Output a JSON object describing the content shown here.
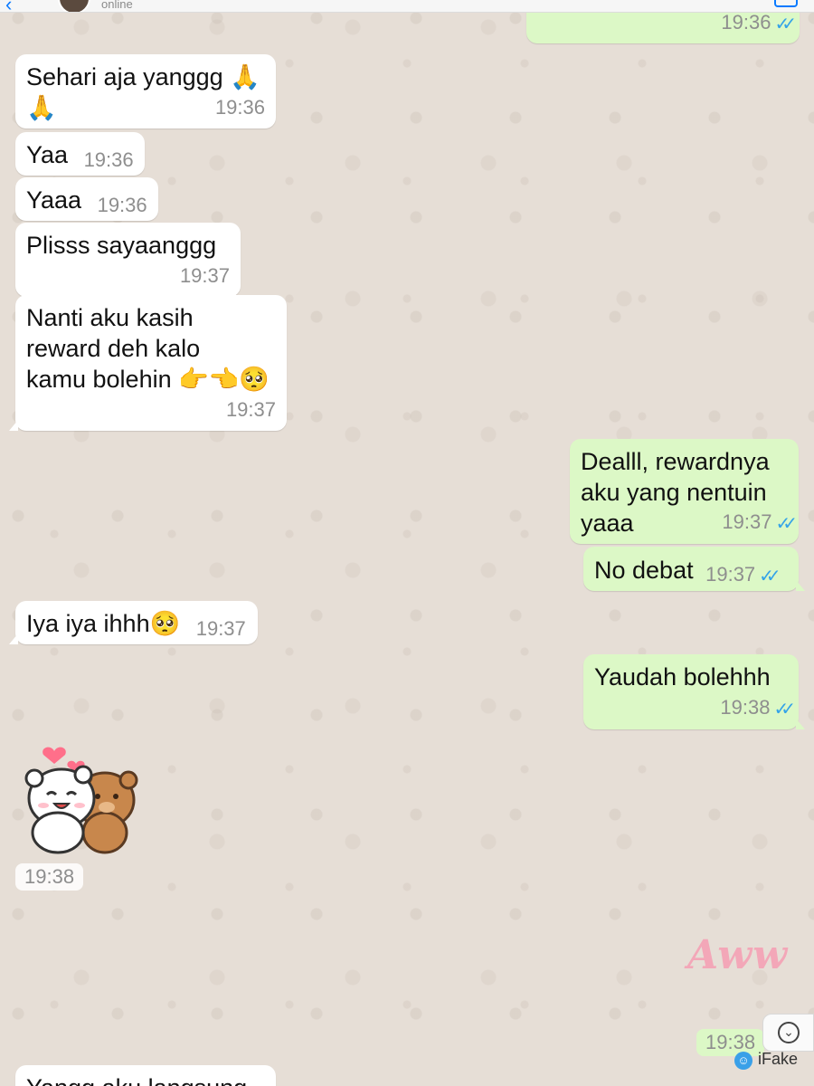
{
  "header": {
    "status": "online"
  },
  "messages": [
    {
      "text": "",
      "time": "19:36",
      "ticks": "✓✓"
    },
    {
      "text": "Sehari aja yanggg 🙏\n🙏",
      "time": "19:36"
    },
    {
      "text": "Yaa",
      "time": "19:36"
    },
    {
      "text": "Yaaa",
      "time": "19:36"
    },
    {
      "text": "Plisss sayaanggg",
      "time": "19:37"
    },
    {
      "text": "Nanti aku kasih\nreward deh kalo\nkamu bolehin 👉👈🥺",
      "time": "19:37"
    },
    {
      "text": "Dealll, rewardnya\naku yang nentuin\nyaaa",
      "time": "19:37",
      "ticks": "✓✓"
    },
    {
      "text": "No debat",
      "time": "19:37",
      "ticks": "✓✓"
    },
    {
      "text": "Iya iya ihhh🥺",
      "time": "19:37"
    },
    {
      "text": "Yaudah bolehhh",
      "time": "19:38",
      "ticks": "✓✓"
    },
    {
      "text": "Yangg aku langsung",
      "time": ""
    }
  ],
  "sticker": {
    "time": "19:38"
  },
  "aww_sticker": {
    "text": "Aww",
    "time": "19:38"
  },
  "watermark": {
    "label": "iFake"
  },
  "colors": {
    "incoming": "#ffffff",
    "outgoing": "#dcf8c6",
    "tick_blue": "#34a3e8",
    "wallpaper": "#e6ded6"
  }
}
